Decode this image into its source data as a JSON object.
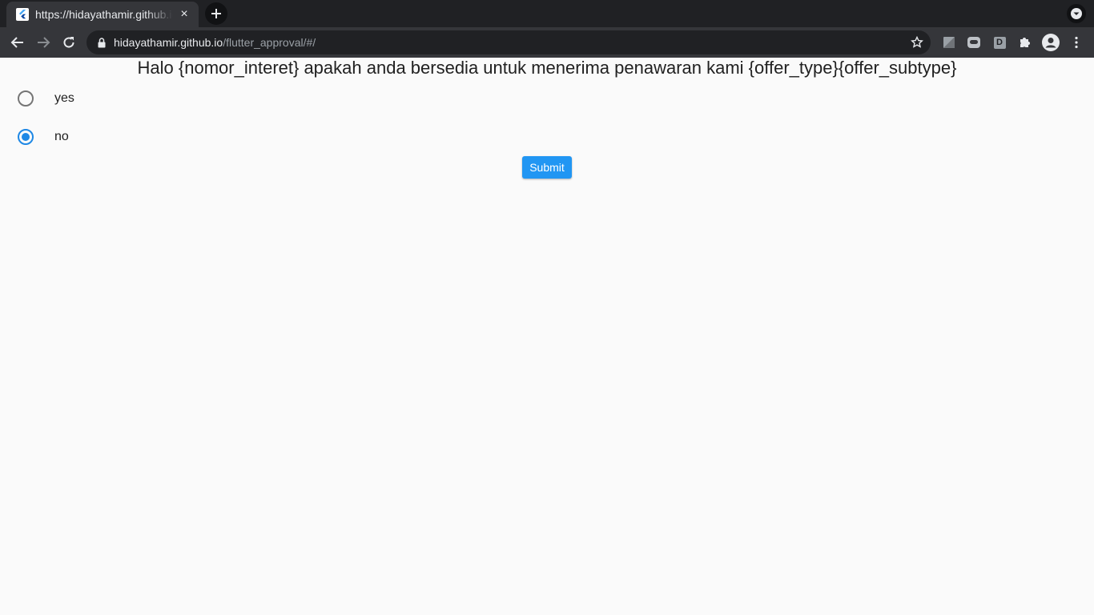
{
  "browser": {
    "tab_title": "https://hidayathamir.github.io/flutter_approval/#/",
    "tab_close": "×",
    "new_tab": "+",
    "url_host": "hidayathamir.github.io",
    "url_path": "/flutter_approval/#/",
    "extension_d_label": "D"
  },
  "page": {
    "headline": "Halo {nomor_interet} apakah anda bersedia untuk menerima penawaran kami {offer_type}{offer_subtype}",
    "options": [
      {
        "label": "yes",
        "selected": false
      },
      {
        "label": "no",
        "selected": true
      }
    ],
    "submit_label": "Submit"
  },
  "colors": {
    "accent": "#1e88e5",
    "button": "#2196f3",
    "chrome_dark": "#202124",
    "chrome_toolbar": "#35363a"
  }
}
